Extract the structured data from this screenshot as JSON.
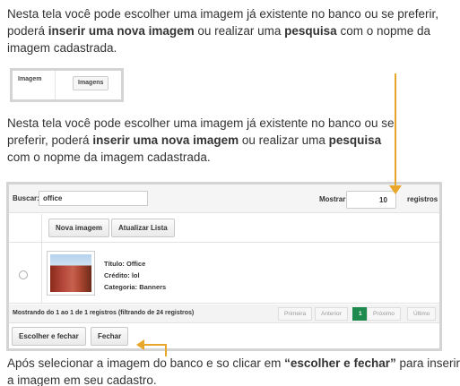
{
  "intro_text": {
    "p1_a": "Nesta tela você pode escolher uma imagem já existente no banco ou se preferir, poderá ",
    "p1_b": "inserir uma nova imagem",
    "p1_c": " ou realizar uma ",
    "p1_d": "pesquisa",
    "p1_e": " com o nopme da imagem cadastrada.",
    "p2_a": "Nesta tela você pode escolher uma imagem já existente no banco ou se preferir, poderá ",
    "p2_b": "inserir uma nova imagem",
    "p2_c": " ou realizar uma ",
    "p2_d": "pesquisa",
    "p2_e": " com o nopme da imagem cadastrada."
  },
  "mini_tabs": {
    "tab_label": "Imagem",
    "button_label": "Imagens"
  },
  "toolbar": {
    "search_label": "Buscar:",
    "search_value": "office",
    "show_label": "Mostrar",
    "show_value": "10",
    "records_label": "registros"
  },
  "buttons": {
    "new_image": "Nova imagem",
    "refresh_list": "Atualizar Lista",
    "choose_close": "Escolher e fechar",
    "close": "Fechar"
  },
  "item": {
    "title_label": "Título:",
    "title_value": "Office",
    "credit_label": "Crédito:",
    "credit_value": "lol",
    "category_label": "Categoria:",
    "category_value": "Banners"
  },
  "footer": {
    "showing_text": "Mostrando do 1 ao 1 de 1 registros (filtrando de 24 registros)",
    "first": "Primeira",
    "prev": "Anterior",
    "page": "1",
    "next": "Próximo",
    "last": "Último"
  },
  "outro_text": {
    "a": "Após selecionar a imagem do banco e so clicar em ",
    "b": "“escolher e fechar”",
    "c": " para inserir a imagem em seu cadastro."
  },
  "colors": {
    "accent_arrow": "#e8a62a",
    "active_page": "#1f8a4d"
  }
}
